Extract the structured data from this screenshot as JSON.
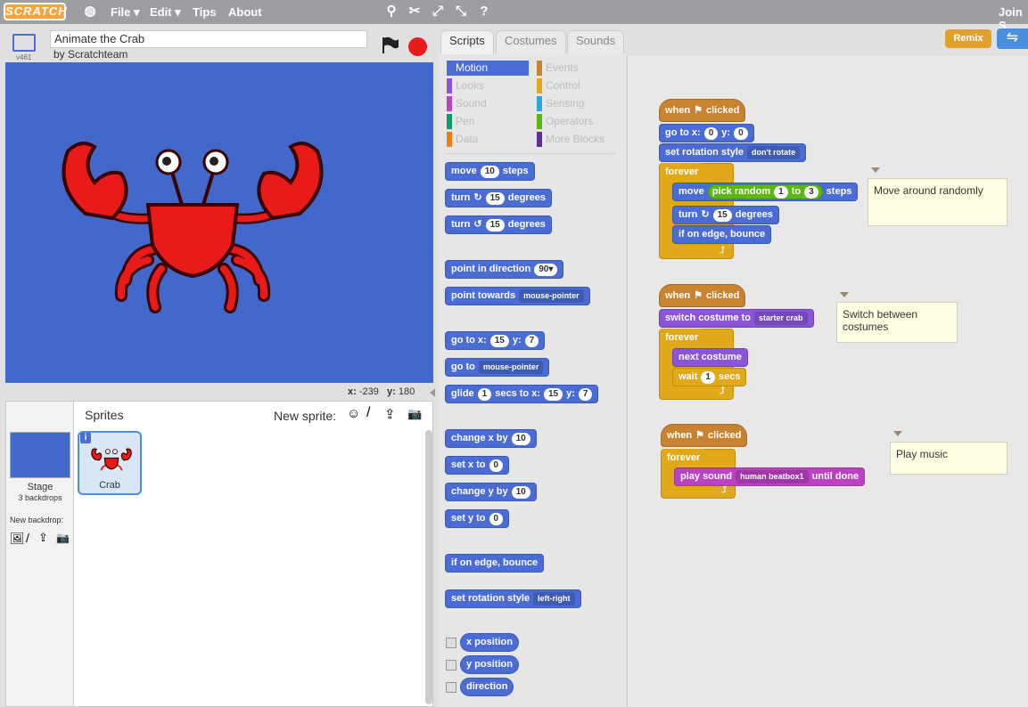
{
  "topbar": {
    "logo": "SCRATCH",
    "menus": [
      "File ▾",
      "Edit ▾",
      "Tips",
      "About"
    ],
    "join": "Join S"
  },
  "stage": {
    "project_title": "Animate the Crab",
    "author": "by Scratchteam",
    "version": "v461",
    "coords_x_label": "x:",
    "coords_x": "-239",
    "coords_y_label": "y:",
    "coords_y": "180"
  },
  "sprites": {
    "header": "Sprites",
    "new_sprite": "New sprite:",
    "stage_label": "Stage",
    "backdrops": "3 backdrops",
    "new_backdrop": "New backdrop:",
    "sprite_name": "Crab"
  },
  "tabs": {
    "scripts": "Scripts",
    "costumes": "Costumes",
    "sounds": "Sounds"
  },
  "remix": "Remix",
  "categories": {
    "motion": "Motion",
    "looks": "Looks",
    "sound": "Sound",
    "pen": "Pen",
    "data": "Data",
    "events": "Events",
    "control": "Control",
    "sensing": "Sensing",
    "operators": "Operators",
    "more": "More Blocks"
  },
  "palette": {
    "move": "move",
    "move_val": "10",
    "steps": "steps",
    "turn": "turn",
    "turn_val": "15",
    "degrees": "degrees",
    "point_dir": "point in direction",
    "point_dir_val": "90▾",
    "point_towards": "point towards",
    "mouse_pointer": "mouse-pointer",
    "go_to": "go to x:",
    "go_x": "15",
    "go_y_label": "y:",
    "go_y": "7",
    "go_to2": "go to",
    "glide": "glide",
    "glide_secs": "1",
    "glide_secs_label": "secs to x:",
    "change_x": "change x by",
    "change_x_val": "10",
    "set_x": "set x to",
    "set_x_val": "0",
    "change_y": "change y by",
    "change_y_val": "10",
    "set_y": "set y to",
    "set_y_val": "0",
    "edge": "if on edge, bounce",
    "rot_style": "set rotation style",
    "rot_val": "left-right",
    "x_pos": "x position",
    "y_pos": "y position",
    "direction": "direction"
  },
  "script1": {
    "when": "when",
    "clicked": "clicked",
    "goto": "go to x:",
    "gx": "0",
    "gy_label": "y:",
    "gy": "0",
    "rot": "set rotation style",
    "rot_val": "don't rotate",
    "forever": "forever",
    "move": "move",
    "pick": "pick random",
    "p1": "1",
    "to": "to",
    "p2": "3",
    "steps": "steps",
    "turn": "turn",
    "turn_val": "15",
    "degrees": "degrees",
    "edge": "if on edge, bounce",
    "note": "Move around randomly"
  },
  "script2": {
    "when": "when",
    "clicked": "clicked",
    "switch": "switch costume to",
    "costume": "starter crab",
    "forever": "forever",
    "next": "next costume",
    "wait": "wait",
    "wait_val": "1",
    "secs": "secs",
    "note": "Switch between costumes"
  },
  "script3": {
    "when": "when",
    "clicked": "clicked",
    "forever": "forever",
    "play": "play sound",
    "sound": "human beatbox1",
    "until": "until done",
    "note": "Play music"
  }
}
